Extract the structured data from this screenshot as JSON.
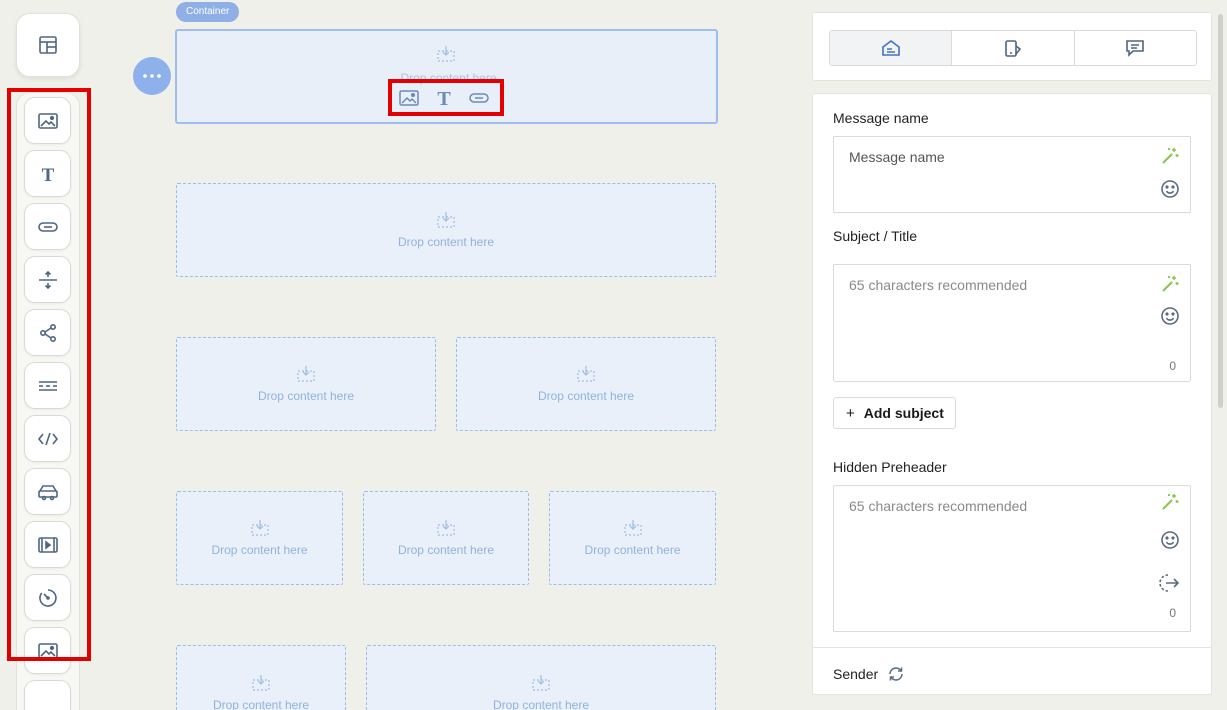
{
  "toolbar": {
    "layout_icon": "layout-grid-icon",
    "tools": [
      {
        "name": "image-tool",
        "icon": "image-icon"
      },
      {
        "name": "text-tool",
        "icon": "text-t-icon"
      },
      {
        "name": "button-tool",
        "icon": "button-pill-icon"
      },
      {
        "name": "spacer-tool",
        "icon": "spacer-icon"
      },
      {
        "name": "social-tool",
        "icon": "share-icon"
      },
      {
        "name": "divider-tool",
        "icon": "divider-icon"
      },
      {
        "name": "html-tool",
        "icon": "code-icon"
      },
      {
        "name": "product-tool",
        "icon": "product-icon"
      },
      {
        "name": "video-tool",
        "icon": "video-icon"
      },
      {
        "name": "timer-tool",
        "icon": "timer-icon"
      },
      {
        "name": "image-block-tool",
        "icon": "image-icon"
      }
    ],
    "highlight_color": "#e30000"
  },
  "canvas": {
    "container_tag": "Container",
    "drop_text": "Drop content here",
    "quick_tools": [
      "image-icon",
      "text-t-icon",
      "button-pill-icon"
    ],
    "accent": "#8eb1ec"
  },
  "panel": {
    "tabs": [
      {
        "icon": "envelope-settings-icon",
        "active": true
      },
      {
        "icon": "mobile-icon",
        "active": false
      },
      {
        "icon": "chat-icon",
        "active": false
      }
    ],
    "message_name": {
      "label": "Message name",
      "value": "Message name"
    },
    "subject": {
      "label": "Subject / Title",
      "placeholder": "65 characters recommended",
      "count": "0"
    },
    "add_subject": "Add subject",
    "add_subject_plus": "+",
    "preheader": {
      "label": "Hidden Preheader",
      "placeholder": "65 characters recommended",
      "count": "0"
    },
    "sender": {
      "label": "Sender"
    },
    "ai_color": "#8bc34a",
    "icon_color": "#5a6b80"
  }
}
